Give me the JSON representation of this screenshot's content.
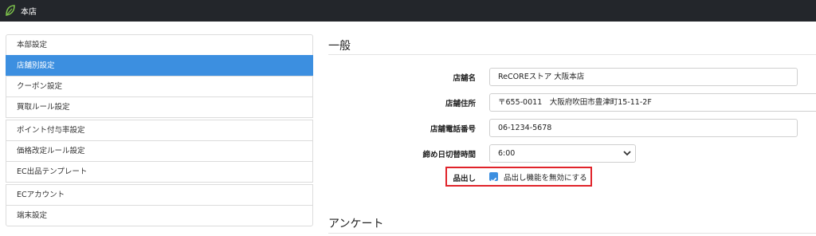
{
  "header": {
    "store_name": "本店"
  },
  "sidebar": {
    "items": [
      {
        "label": "本部設定"
      },
      {
        "label": "店舗別設定"
      },
      {
        "label": "クーポン設定"
      },
      {
        "label": "買取ルール設定"
      },
      {
        "label": "ポイント付与率設定"
      },
      {
        "label": "価格改定ルール設定"
      },
      {
        "label": "EC出品テンプレート"
      },
      {
        "label": "ECアカウント"
      },
      {
        "label": "端末設定"
      }
    ],
    "active_index": 1
  },
  "general": {
    "title": "一般",
    "store_name_label": "店舗名",
    "store_name_value": "ReCOREストア 大阪本店",
    "address_label": "店舗住所",
    "address_value": "〒655-0011　大阪府吹田市豊津町15-11-2F",
    "phone_label": "店舗電話番号",
    "phone_value": "06-1234-5678",
    "closing_label": "締め日切替時間",
    "closing_value": "6:00",
    "picking_label": "品出し",
    "picking_checkbox_label": "品出し機能を無効にする",
    "picking_checked": true
  },
  "survey": {
    "title": "アンケート"
  },
  "colors": {
    "accent": "#3c8fe0",
    "highlight": "#e0232a",
    "topbar": "#23262b"
  }
}
